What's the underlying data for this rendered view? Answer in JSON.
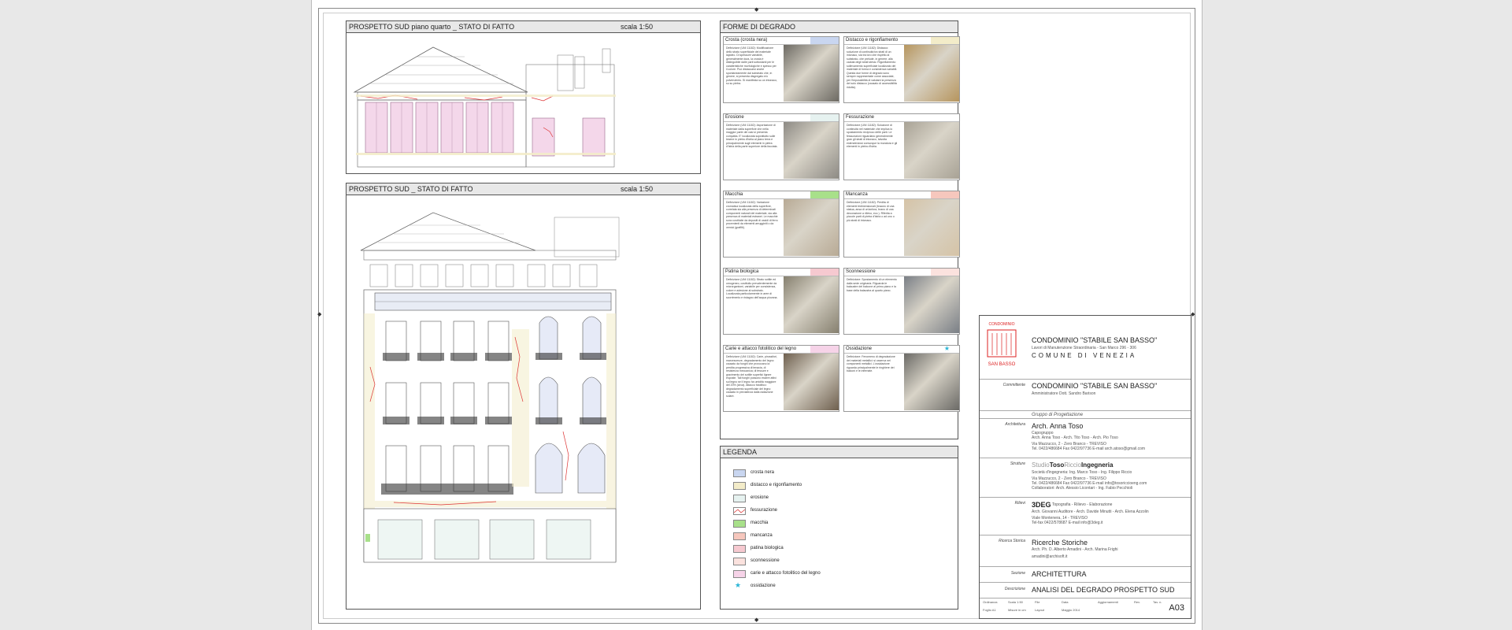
{
  "drawings": {
    "upper": {
      "title": "PROSPETTO SUD piano quarto _ STATO DI FATTO",
      "scale": "scala 1:50"
    },
    "lower": {
      "title": "PROSPETTO SUD _ STATO DI FATTO",
      "scale": "scala 1:50"
    }
  },
  "forme": {
    "title": "FORME DI DEGRADO",
    "cards": [
      {
        "name": "Crosta (crosta nera)",
        "swatch": "#c9d6f0",
        "text": "Definizione (UNI 11182): Modificazione dello strato superficiale del materiale lapideo. Di spessore variabile, generalmente dura, la crosta è distinguibile dalle parti sottostanti per le caratteristiche morfologiche e spesso per il colore. Può distaccarsi anche spontaneamente dal substrato che, in genere, si presenta disgregato e/o polverulento. Si manifesta su un intonaco, su su pietra.",
        "photo": "#6d6a63"
      },
      {
        "name": "Distacco e rigonfiamento",
        "swatch": "#f3ecc9",
        "text": "Definizione (UNI 11182): Distacco: soluzione di continuità tra strati di un intonaco, sia tra loro che rispetto al substrato, che prelude, in genere, alla caduta degli strati stessi. Rigonfiamento: sollevamento superficiale localizzato del materiale di forma e consistenza variabili. Questa due forme di degrado sono sempre rappresentate come associate, per l'impossibilità di valutare la presenza del solo distacco (causato di accessibilità ridotta).",
        "photo": "#b6955e"
      },
      {
        "name": "Erosione",
        "swatch": "#e6f2f0",
        "text": "Definizione (UNI 11182): Asportazione di materiale dalla superficie che nella maggior parte dei casi si presenta compatta. E' localizzata soprattutto sulle lesene in pietra d'Istria al piano terra e principalmente sugli elementi in pietra d'Istria della parte superiore della facciata.",
        "photo": "#8d8a84"
      },
      {
        "name": "Fessurazione",
        "swatch": "#ffffff",
        "text": "Definizione (UNI 11182): Soluzione di continuità nel materiale che implica lo spostamento reciproco delle parti. Le fessurazioni riguardano generalmente gran gli strati di intonaco, talvolta estendendosi comunque la muratura e gli elementi in pietra d'Istria.",
        "photo": "#a8a295"
      },
      {
        "name": "Macchia",
        "swatch": "#a8e08a",
        "text": "Definizione (UNI 11182): Variazione cromatica localizzata della superficie, correlata sia alla presenza di determinati componenti naturali del materiale, sia alla presenza di materiali estranei. Le macchie sono costituite da depositi di ossidi di ferro provenienti da elementi arrugginiti o da vernici (graffiti).",
        "photo": "#b8aa95"
      },
      {
        "name": "Mancanza",
        "swatch": "#f6c7bd",
        "text": "Definizione (UNI 11182): Perdita di elementi tridimensionali (braccio di una statua, ansa di un'anfora, brano di una decorazione a rilievo, ecc.). Riferita a piccole parti di pietra d'Istria o ad uno o più strati di intonaco.",
        "photo": "#d5c3a6"
      },
      {
        "name": "Patina biologica",
        "swatch": "#f6c9d0",
        "text": "Definizione (UNI 11182): Strato sottile ed omogeneo, costituito prevalentemente da microrganismi, variabile per consistenza, colore e adesione al substrato. Localizzata particolarmente in aree di scorrimento e ristagno dell'acqua piovana.",
        "photo": "#86806f"
      },
      {
        "name": "Sconnessione",
        "swatch": "#fbe2de",
        "text": "Definizione: Spostamento di un elemento dalla sede originaria. Riguarda le balaustre del balcone al primo piano e la base della balaustra al quarto piano.",
        "photo": "#7a7f86"
      },
      {
        "name": "Carie e attacco fotolitico del legno",
        "swatch": "#f6d3e8",
        "text": "Definizione (UNI 11182): Carie, pirossifori, marcescenze, degradamento del legno causato da funghi che provocano la perdita progressiva di tenacia, di resistenza meccanica; di fessure e gravimento del sottile superfici lignee esposte. Tali funghi possono essere attivi sul legno se il legno ha umidità maggiore del 20% (circa). Attacco fotolitico: degradamento superficiale del legno causato in prevalenza dalla radiazione solare.",
        "photo": "#6e5f4e"
      },
      {
        "name": "Ossidazione",
        "swatch": "#ffffff",
        "star": "★",
        "text": "Definizione: Fenomeno di degradazione dei materiali metallici: si osserva nei componenti metallici. L'ossidazione riguarda principalmente le ringhiere dei balconi e le inferriate.",
        "photo": "#6b6a66"
      }
    ]
  },
  "legend": {
    "title": "LEGENDA",
    "items": [
      {
        "label": "crosta nera",
        "fill": "#c9d6f0"
      },
      {
        "label": "distacco e rigonfiamento",
        "fill": "#f3ecc9"
      },
      {
        "label": "erosione",
        "fill": "#e6f2f0"
      },
      {
        "label": "fessurazione",
        "fill": "#ffffff",
        "line": "#d33"
      },
      {
        "label": "macchia",
        "fill": "#a8e08a"
      },
      {
        "label": "mancanza",
        "fill": "#f6c7bd"
      },
      {
        "label": "patina biologica",
        "fill": "#f6c9d0"
      },
      {
        "label": "sconnessione",
        "fill": "#fbe2de"
      },
      {
        "label": "carie e attacco fotolitico del legno",
        "fill": "#f6d3e8"
      },
      {
        "label": "ossidazione",
        "fill": "#ffffff",
        "star": "★"
      }
    ]
  },
  "titleblock": {
    "logo_top": "CONDOMINIO",
    "logo_bottom": "SAN BASSO",
    "condo_title": "CONDOMINIO \"STABILE SAN BASSO\"",
    "works": "Lavori di Manutenzione Straordinaria  -  San Marco 296 - 306",
    "comune": "COMUNE  DI  VENEZIA",
    "committente_label": "Committente",
    "committente_name": "CONDOMINIO \"STABILE SAN BASSO\"",
    "committente_admin": "Amministratore Dott. Sandro Barison",
    "gruppo": "Gruppo di Progettazione",
    "arch_label": "Architettura",
    "arch_name": "Arch. Anna Toso",
    "arch_role": "Capogruppo",
    "arch_team": "Arch. Anna Toso - Arch. Tito Toso - Arch. Pio Toso",
    "arch_addr": "Via Mazzucco, 2 - Zero Branco - TREVISO",
    "arch_tel": "Tel. 0422/486684  Fax 0422/97736 E-mail arch.atoso@gmail.com",
    "strutture_label": "Strutture",
    "studio_a": "Studio",
    "studio_b": "Toso",
    "studio_c": "Riccio",
    "studio_d": "Ingegneria",
    "strutture_soc": "Società d'ingegneria: Ing. Marco Toso - Ing. Filippo Riccio",
    "strutture_addr": "Via Mazzucco, 2 - Zero Branco - TREVISO",
    "strutture_tel": "Tel. 0422/486684  Fax 0422/97736 E-mail info@tosoriccioeng.com",
    "strutture_collab": "Collaboratori: Arch. Alessio Licontari - Ing. Fabio Pecchioli",
    "rilievi_label": "Rilievi",
    "rilievi_name": "3DEG",
    "rilievi_desc": "Topografia  -  Rilievo  -  Elaborazione",
    "rilievi_team": "Arch. Giovanni Auditore - Arch. Davide Minutti - Arch. Elena Azzolin",
    "rilievi_addr": "Viale Montenera, 14 - TREVISO",
    "rilievi_tel": "Tel-fax 0422/578687 E-mail info@3deg.it",
    "ricerca_label": "Ricerca Storica",
    "ricerca_name": "Ricerche Storiche",
    "ricerca_team": "Arch. Ph. D. Alberto Amadini - Arch. Marina Frighi",
    "ricerca_mail": "amadini@archisoft.it",
    "sezione_label": "Sezione",
    "sezione_val": "ARCHITETTURA",
    "descr_label": "Descrizione",
    "descr_val": "ANALISI DEL DEGRADO PROSPETTO SUD",
    "code": "A03",
    "foot_1": "Ordinanza",
    "foot_2": "Foglio A1",
    "foot_3": "Scala 1:50",
    "foot_4": "Misure in cm",
    "foot_5": "File",
    "foot_6": "Layout",
    "foot_7": "Data",
    "foot_8": "Maggio 2014",
    "foot_9": "Aggiornamenti",
    "foot_10": "Rev.",
    "foot_11": "Tav. n."
  }
}
